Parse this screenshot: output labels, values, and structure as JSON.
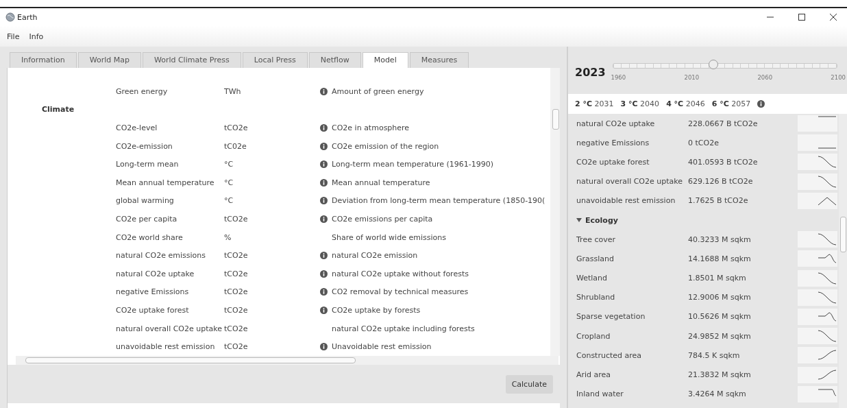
{
  "window": {
    "title": "Earth"
  },
  "menu": [
    "File",
    "Info"
  ],
  "tabs": [
    {
      "label": "Information",
      "selected": false
    },
    {
      "label": "World Map",
      "selected": false
    },
    {
      "label": "World Climate Press",
      "selected": false
    },
    {
      "label": "Local Press",
      "selected": false
    },
    {
      "label": "Netflow",
      "selected": false
    },
    {
      "label": "Model",
      "selected": true
    },
    {
      "label": "Measures",
      "selected": false
    }
  ],
  "model_rows": [
    {
      "kind": "row",
      "name": "Green energy",
      "unit": "TWh",
      "info": true,
      "description": "Amount of green energy"
    },
    {
      "kind": "group",
      "name": "Climate"
    },
    {
      "kind": "row",
      "name": "CO2e-level",
      "unit": "tCO2e",
      "info": true,
      "description": "CO2e in atmosphere"
    },
    {
      "kind": "row",
      "name": "CO2e-emission",
      "unit": "tC02e",
      "info": true,
      "description": "CO2e emission of the region"
    },
    {
      "kind": "row",
      "name": "Long-term mean",
      "unit": "°C",
      "info": true,
      "description": "Long-term mean temperature (1961-1990)"
    },
    {
      "kind": "row",
      "name": "Mean annual temperature",
      "unit": "°C",
      "info": true,
      "description": "Mean annual temperature"
    },
    {
      "kind": "row",
      "name": "global warming",
      "unit": "°C",
      "info": true,
      "description": "Deviation from long-term mean temperature (1850-190("
    },
    {
      "kind": "row",
      "name": "CO2e per capita",
      "unit": "tCO2e",
      "info": true,
      "description": "CO2e emissions per capita"
    },
    {
      "kind": "row",
      "name": "CO2e world share",
      "unit": "%",
      "info": false,
      "description": "Share of world wide emissions"
    },
    {
      "kind": "row",
      "name": "natural CO2e emissions",
      "unit": "tCO2e",
      "info": true,
      "description": "natural CO2e emission"
    },
    {
      "kind": "row",
      "name": "natural CO2e uptake",
      "unit": "tCO2e",
      "info": true,
      "description": "natural CO2e uptake without forests"
    },
    {
      "kind": "row",
      "name": "negative Emissions",
      "unit": "tCO2e",
      "info": true,
      "description": "CO2 removal by technical measures"
    },
    {
      "kind": "row",
      "name": "CO2e uptake forest",
      "unit": "tCO2e",
      "info": true,
      "description": "CO2e uptake by forests"
    },
    {
      "kind": "row",
      "name": "natural overall CO2e uptake",
      "unit": "tCO2e",
      "info": false,
      "description": "natural CO2e uptake including forests"
    },
    {
      "kind": "row",
      "name": "unavoidable rest emission",
      "unit": "tCO2e",
      "info": true,
      "description": "Unavoidable rest emission"
    }
  ],
  "calculate_button": "Calculate",
  "year": {
    "value": "2023",
    "level": 0.45,
    "tick_labels": [
      "1960",
      "2010",
      "2060",
      "2100"
    ]
  },
  "thresholds": [
    {
      "temp": "2 °C",
      "year": "2031"
    },
    {
      "temp": "3 °C",
      "year": "2040"
    },
    {
      "temp": "4 °C",
      "year": "2046"
    },
    {
      "temp": "6 °C",
      "year": "2057"
    }
  ],
  "indicators": [
    {
      "kind": "flat",
      "name": "natural CO2e uptake",
      "value": "228.0667 B tCO2e"
    },
    {
      "kind": "low",
      "name": "negative Emissions",
      "value": "0 tCO2e"
    },
    {
      "kind": "fall",
      "name": "CO2e uptake forest",
      "value": "401.0593 B tCO2e"
    },
    {
      "kind": "fall",
      "name": "natural overall CO2e uptake",
      "value": "629.126 B tCO2e"
    },
    {
      "kind": "peak",
      "name": "unavoidable rest emission",
      "value": "1.7625 B tCO2e"
    },
    {
      "kind": "group",
      "name": "Ecology",
      "expanded": true
    },
    {
      "kind": "fall",
      "name": "Tree cover",
      "value": "40.3233 M sqkm"
    },
    {
      "kind": "bump",
      "name": "Grassland",
      "value": "14.1688 M sqkm"
    },
    {
      "kind": "fall",
      "name": "Wetland",
      "value": "1.8501 M sqkm"
    },
    {
      "kind": "fall",
      "name": "Shrubland",
      "value": "12.9006 M sqkm"
    },
    {
      "kind": "bump",
      "name": "Sparse vegetation",
      "value": "10.5626 M sqkm"
    },
    {
      "kind": "fall",
      "name": "Cropland",
      "value": "24.9852 M sqkm"
    },
    {
      "kind": "rise",
      "name": "Constructed area",
      "value": "784.5 K sqkm"
    },
    {
      "kind": "rise",
      "name": "Arid area",
      "value": "21.3832 M sqkm"
    },
    {
      "kind": "step",
      "name": "Inland water",
      "value": "3.4264 M sqkm"
    }
  ]
}
